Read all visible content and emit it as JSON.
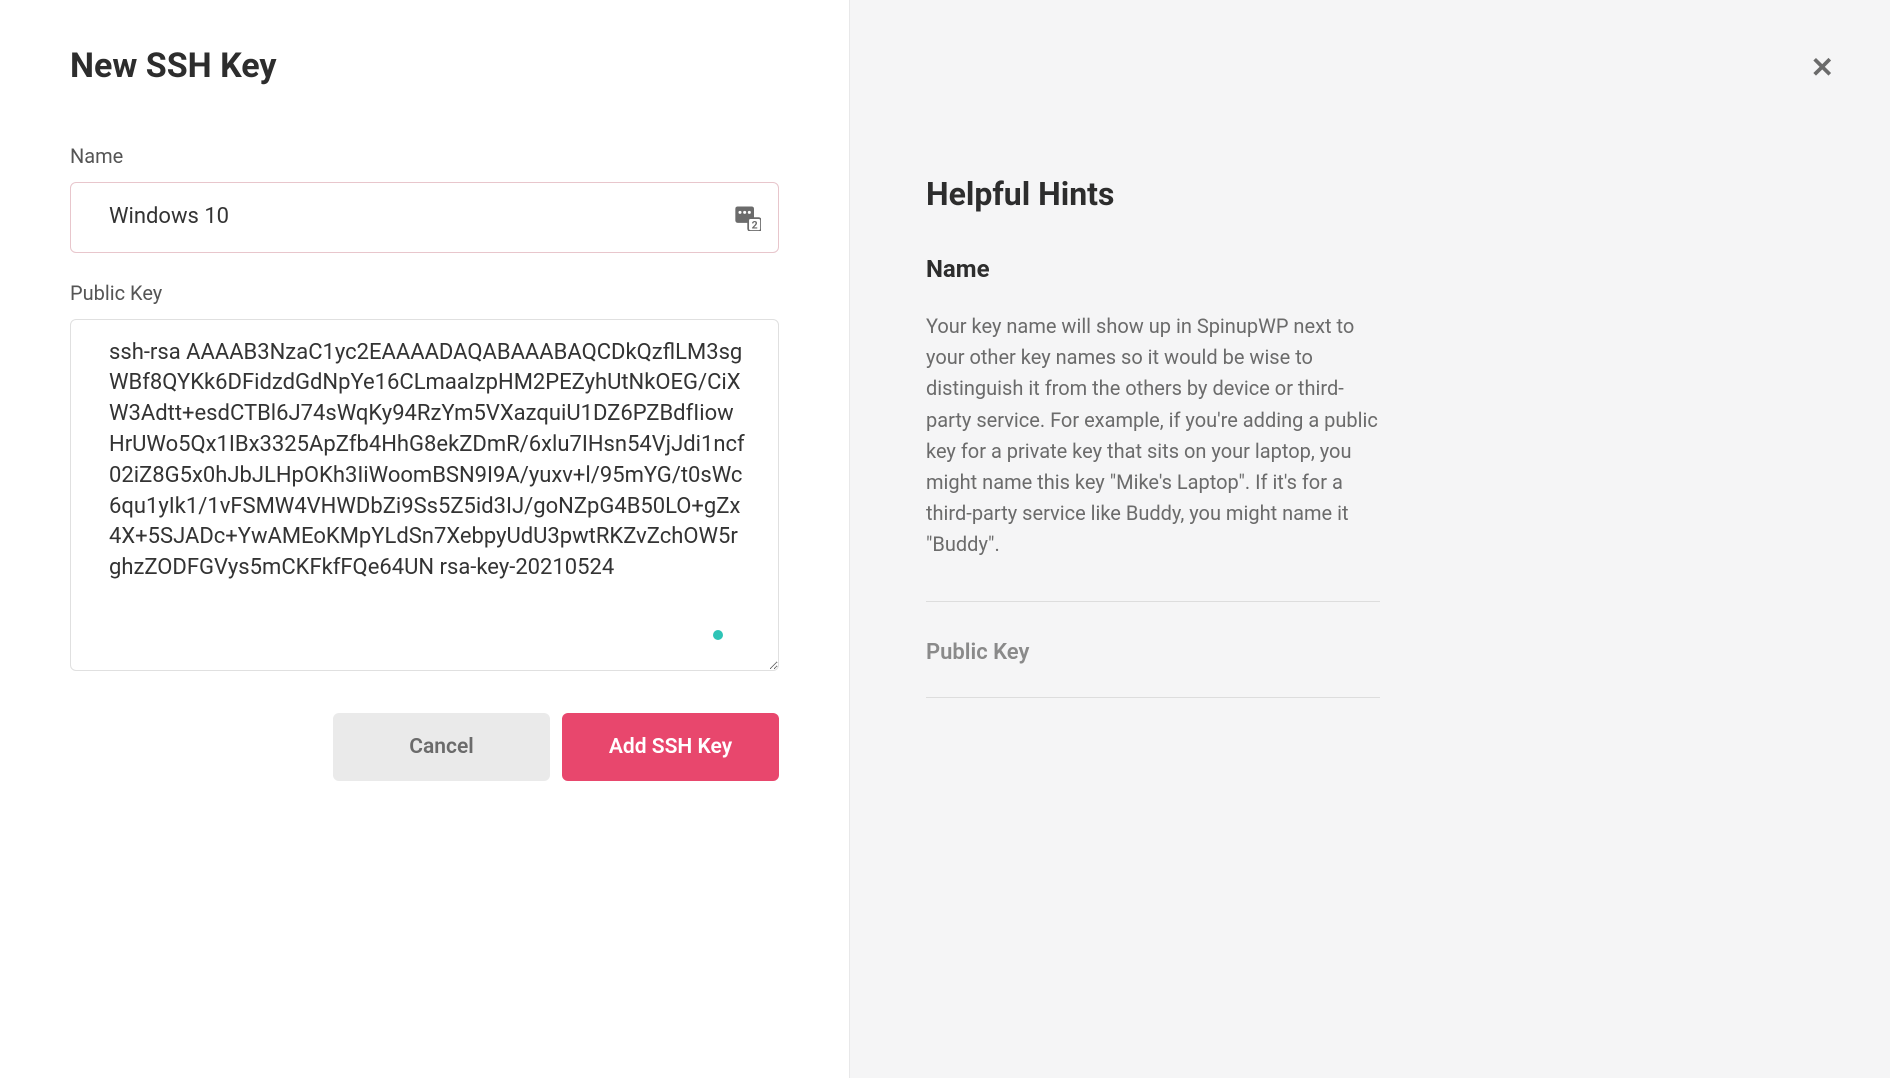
{
  "page": {
    "title": "New SSH Key"
  },
  "form": {
    "name_label": "Name",
    "name_value": "Windows 10",
    "public_key_label": "Public Key",
    "public_key_value": "ssh-rsa AAAAB3NzaC1yc2EAAAADAQABAAABAQCDkQzflLM3sgWBf8QYKk6DFidzdGdNpYe16CLmaaIzpHM2PEZyhUtNkOEG/CiXW3Adtt+esdCTBl6J74sWqKy94RzYm5VXazquiU1DZ6PZBdfIiowHrUWo5Qx1IBx3325ApZfb4HhG8ekZDmR/6xlu7IHsn54VjJdi1ncf02iZ8G5x0hJbJLHpOKh3IiWoomBSN9I9A/yuxv+l/95mYG/t0sWc6qu1yIk1/1vFSMW4VHWDbZi9Ss5Z5id3IJ/goNZpG4B50LO+gZx4X+5SJADc+YwAMEoKMpYLdSn7XebpyUdU3pwtRKZvZchOW5rghzZODFGVys5mCKFkfFQe64UN rsa-key-20210524"
  },
  "buttons": {
    "cancel": "Cancel",
    "submit": "Add SSH Key"
  },
  "hints": {
    "title": "Helpful Hints",
    "name_heading": "Name",
    "name_body": "Your key name will show up in SpinupWP next to your other key names so it would be wise to distinguish it from the others by device or third-party service. For example, if you're adding a public key for a private key that sits on your laptop, you might name this key \"Mike's Laptop\". If it's for a third-party service like Buddy, you might name it \"Buddy\".",
    "public_key_heading": "Public Key"
  },
  "colors": {
    "primary": "#e8476d",
    "muted_bg": "#f5f5f6"
  }
}
